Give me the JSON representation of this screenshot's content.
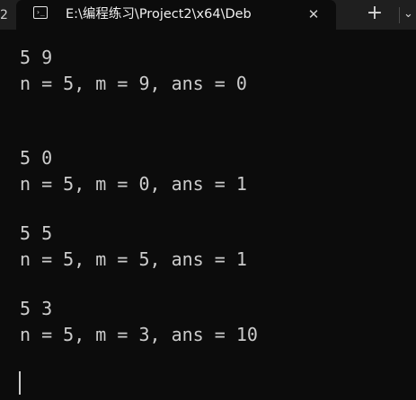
{
  "tabs": {
    "previous_tab_fragment": "2",
    "active": {
      "title": "E:\\编程练习\\Project2\\x64\\Deb",
      "icon": "terminal-icon",
      "close_glyph": "✕"
    },
    "new_tab_glyph": "+",
    "dropdown_glyph": "⌄"
  },
  "terminal": {
    "lines": [
      "5 9",
      "n = 5, m = 9, ans = 0",
      "",
      "",
      "5 0",
      "n = 5, m = 0, ans = 1",
      "",
      "5 5",
      "n = 5, m = 5, ans = 1",
      "",
      "5 3",
      "n = 5, m = 3, ans = 10"
    ],
    "text_color": "#cccccc",
    "background": "#0c0c0c"
  }
}
